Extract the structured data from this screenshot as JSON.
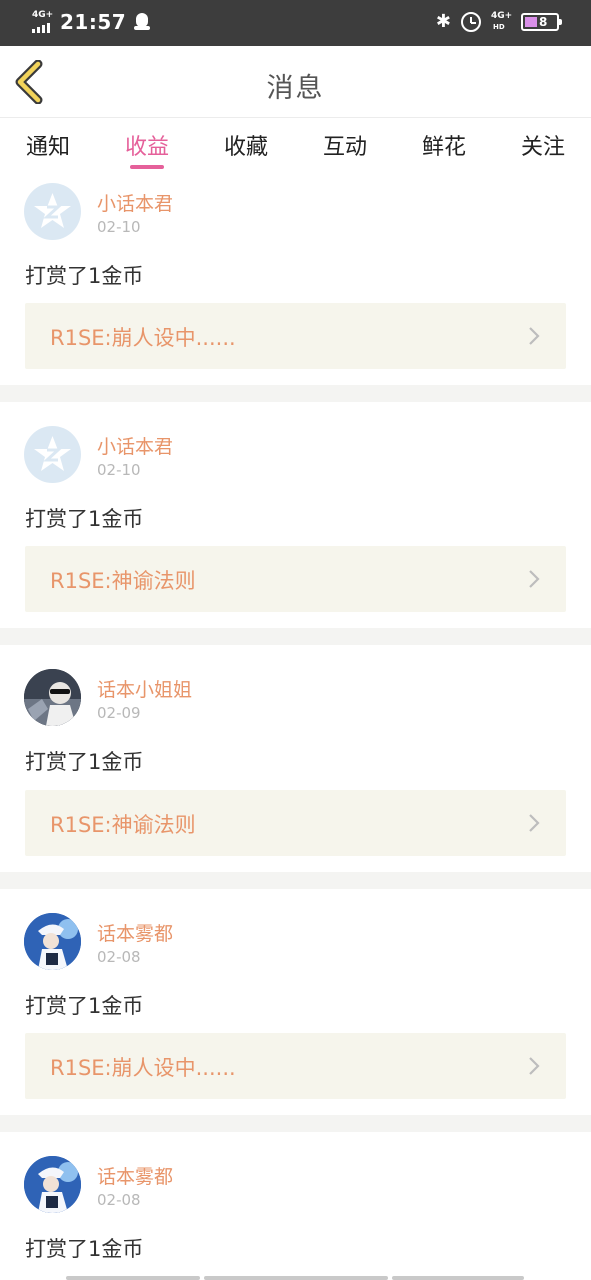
{
  "status_bar": {
    "network_left": "4G+",
    "time": "21:57",
    "network_right": "4G+",
    "network_right_sub": "HD",
    "battery_level": "8",
    "bluetooth_glyph": "✱",
    "icons": [
      "signal-icon",
      "qq-icon",
      "bluetooth-icon",
      "alarm-icon",
      "signal-icon",
      "battery-icon"
    ]
  },
  "header": {
    "title": "消息",
    "back_icon": "chevron-left-icon",
    "accent_color": "#e5609a"
  },
  "tabs": [
    {
      "label": "通知",
      "active": false
    },
    {
      "label": "收益",
      "active": true
    },
    {
      "label": "收藏",
      "active": false
    },
    {
      "label": "互动",
      "active": false
    },
    {
      "label": "鲜花",
      "active": false
    },
    {
      "label": "关注",
      "active": false
    }
  ],
  "items": [
    {
      "user": "小话本君",
      "date": "02-10",
      "message": "打赏了1金币",
      "work": "R1SE:崩人设中......",
      "avatar": "default-avatar"
    },
    {
      "user": "小话本君",
      "date": "02-10",
      "message": "打赏了1金币",
      "work": "R1SE:神谕法则",
      "avatar": "default-avatar"
    },
    {
      "user": "话本小姐姐",
      "date": "02-09",
      "message": "打赏了1金币",
      "work": "R1SE:神谕法则",
      "avatar": "photo-avatar"
    },
    {
      "user": "话本雾都",
      "date": "02-08",
      "message": "打赏了1金币",
      "work": "R1SE:崩人设中......",
      "avatar": "photo-avatar"
    },
    {
      "user": "话本雾都",
      "date": "02-08",
      "message": "打赏了1金币",
      "work": "",
      "avatar": "photo-avatar"
    }
  ]
}
